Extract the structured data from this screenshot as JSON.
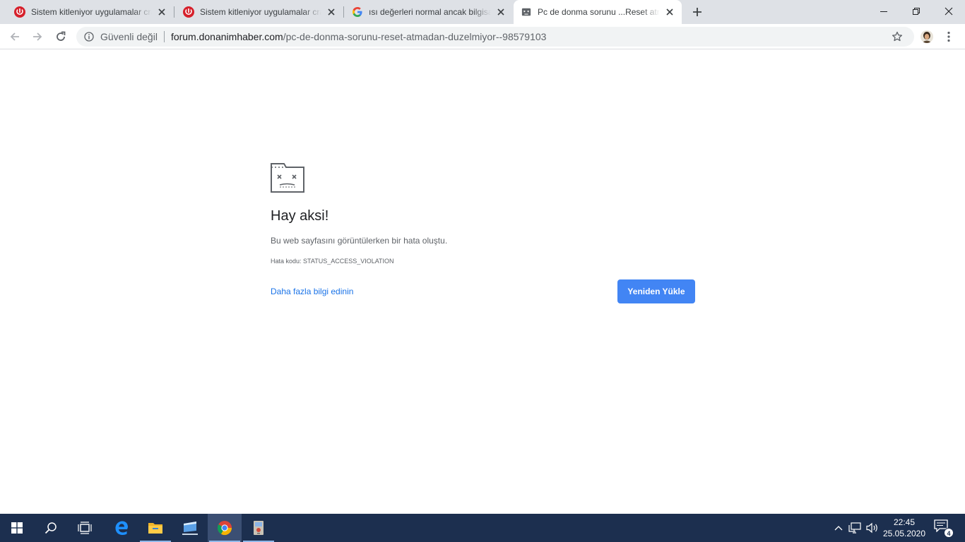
{
  "browser": {
    "tabs": [
      {
        "title": "Sistem kitleniyor uygulamalar crash oluyor",
        "favicon": "donanimhaber-favicon",
        "active": false
      },
      {
        "title": "Sistem kitleniyor uygulamalar crash oluyor",
        "favicon": "donanimhaber-favicon",
        "active": false
      },
      {
        "title": "ısı değerleri normal ancak bilgisayar kapanıyor",
        "favicon": "google-favicon",
        "active": false
      },
      {
        "title": "Pc de donma sorunu ...Reset atmadan düzelmiyor",
        "favicon": "sad-page-favicon",
        "active": true
      }
    ],
    "address_bar": {
      "security_label": "Güvenli değil",
      "url_host": "forum.donanimhaber.com",
      "url_path": "/pc-de-donma-sorunu-reset-atmadan-duzelmiyor--98579103"
    }
  },
  "error_page": {
    "icon": "sad-folder-icon",
    "title": "Hay aksi!",
    "description": "Bu web sayfasını görüntülerken bir hata oluştu.",
    "error_code": "Hata kodu: STATUS_ACCESS_VIOLATION",
    "learn_more": "Daha fazla bilgi edinin",
    "reload_button": "Yeniden Yükle"
  },
  "taskbar": {
    "clock_time": "22:45",
    "clock_date": "25.05.2020",
    "notification_count": "4"
  },
  "colors": {
    "accent": "#4285f4",
    "link": "#1a73e8",
    "taskbar": "#1c2f4f",
    "tabstrip": "#dee1e6"
  }
}
